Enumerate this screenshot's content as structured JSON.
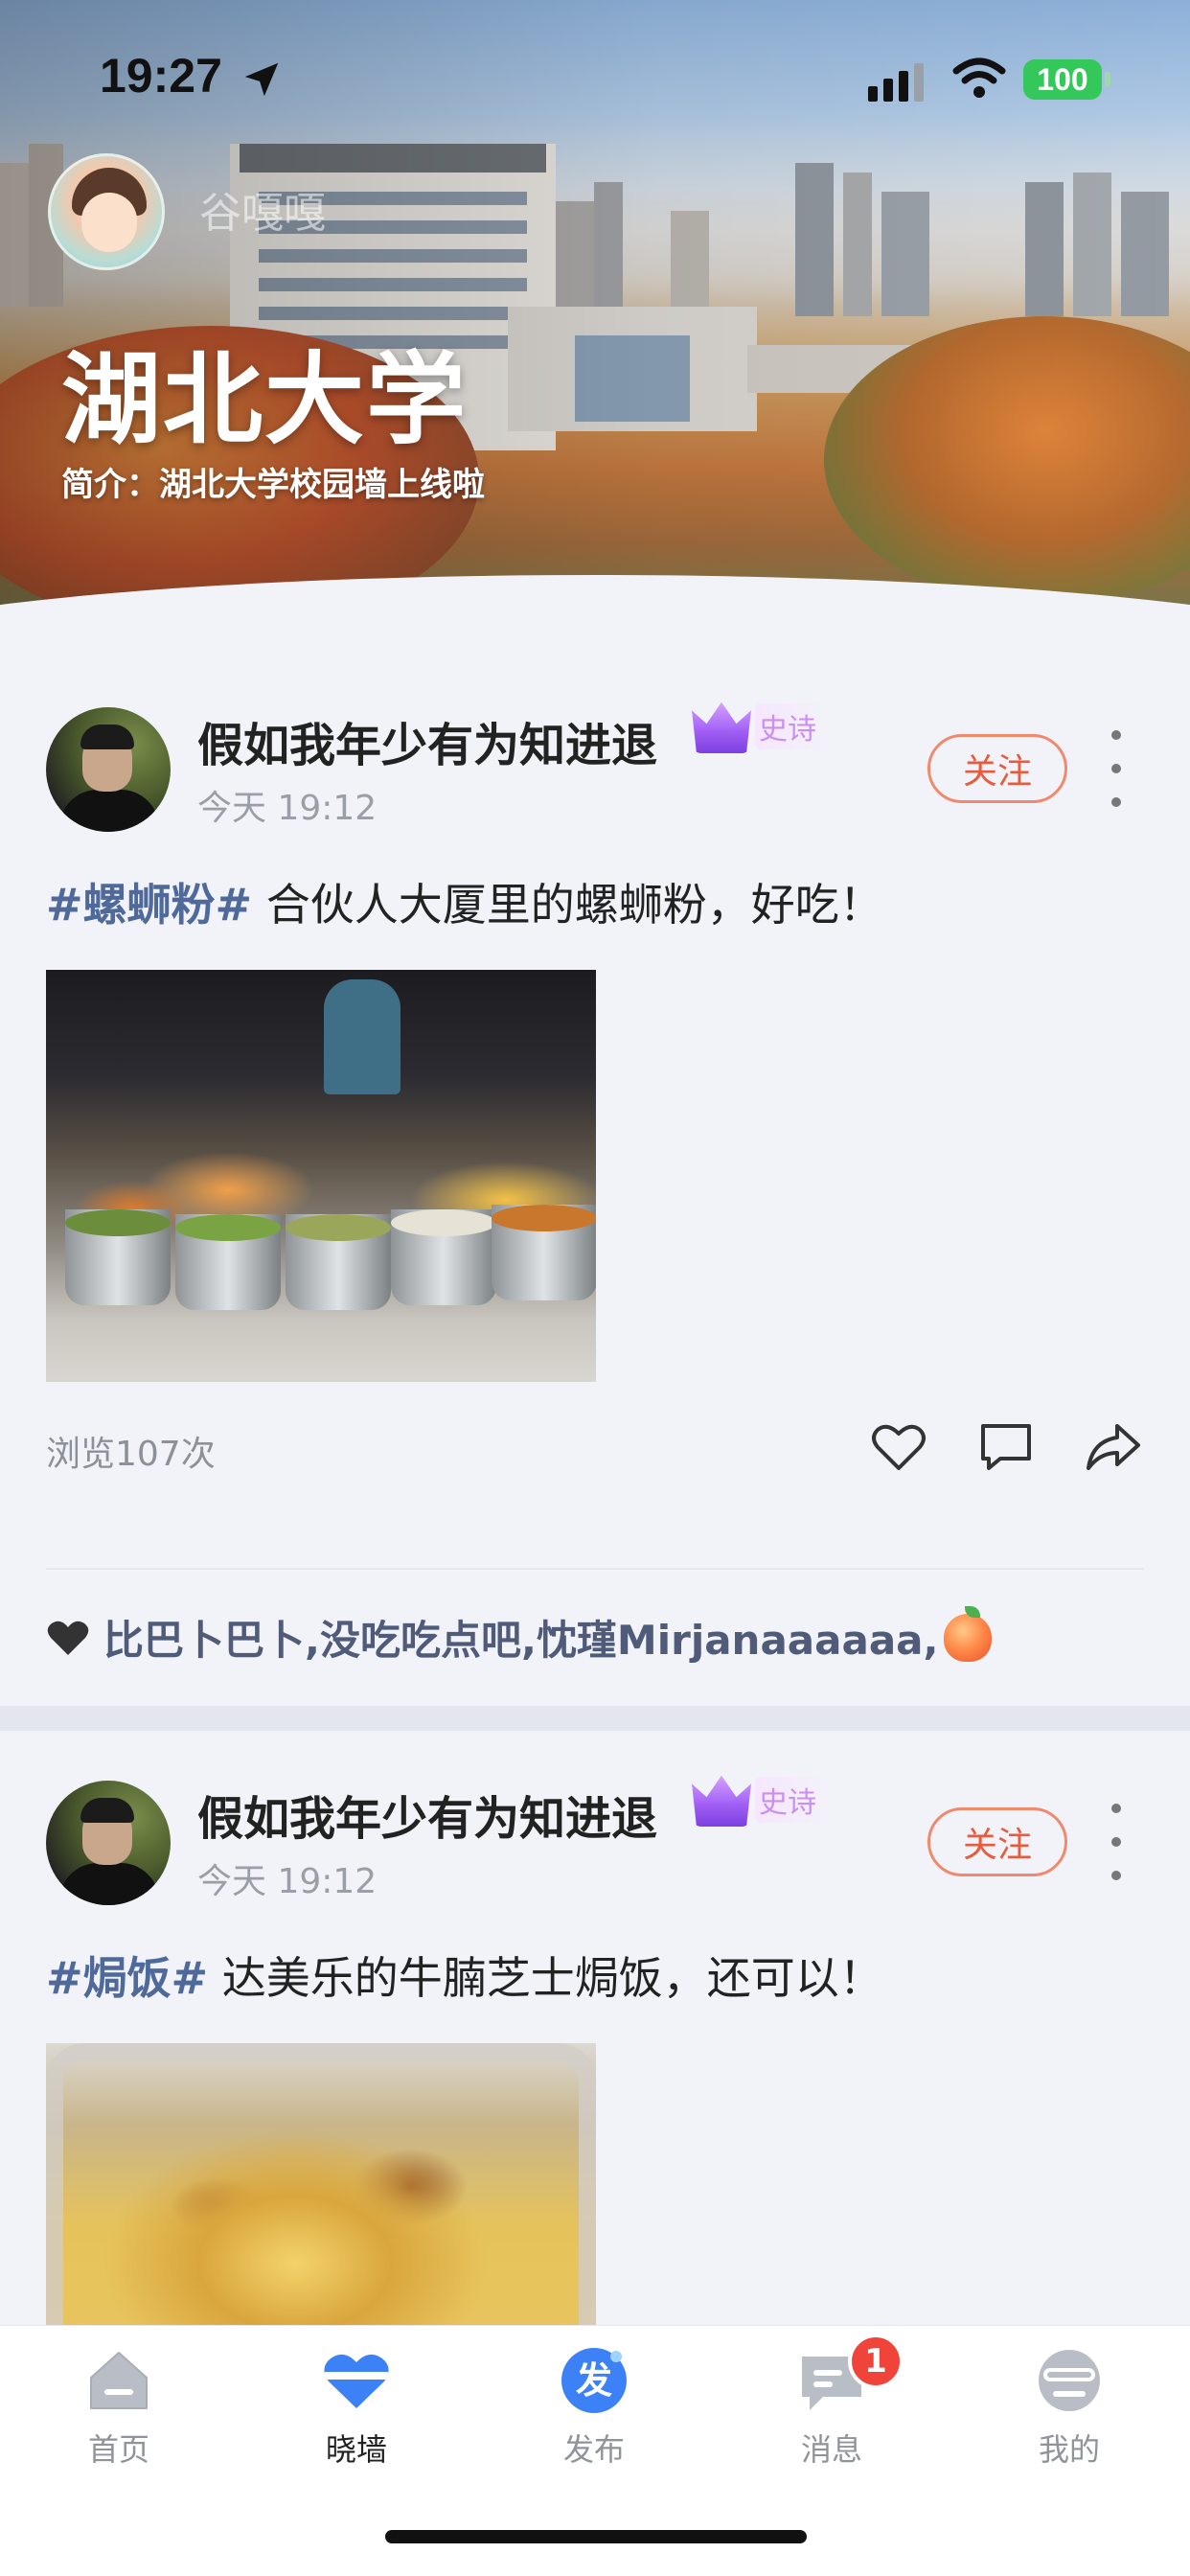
{
  "status_bar": {
    "time": "19:27",
    "battery": "100"
  },
  "header": {
    "username": "谷嘎嘎",
    "school_title": "湖北大学",
    "description": "简介：湖北大学校园墙上线啦"
  },
  "posts": [
    {
      "author": "假如我年少有为知进退",
      "badge": "史诗",
      "time": "今天 19:12",
      "follow_label": "关注",
      "tag": "#螺蛳粉#",
      "text": " 合伙人大厦里的螺蛳粉，好吃！",
      "views": "浏览107次",
      "likes_text": "比巴卜巴卜,没吃吃点吧,忱瑾Mirjanaaaaaa,"
    },
    {
      "author": "假如我年少有为知进退",
      "badge": "史诗",
      "time": "今天 19:12",
      "follow_label": "关注",
      "tag": "#焗饭#",
      "text": " 达美乐的牛腩芝士焗饭，还可以！"
    }
  ],
  "tabbar": {
    "items": [
      {
        "label": "首页",
        "icon": "home-icon"
      },
      {
        "label": "晓墙",
        "icon": "heart-wall-icon",
        "active": true
      },
      {
        "label": "发布",
        "icon": "publish-icon",
        "glyph": "发"
      },
      {
        "label": "消息",
        "icon": "message-icon",
        "badge": "1"
      },
      {
        "label": "我的",
        "icon": "profile-icon"
      }
    ]
  },
  "colors": {
    "accent_blue": "#3c82f6",
    "follow_red": "#e85b3d",
    "tag_blue": "#4f6a9a",
    "badge_red": "#f0443a",
    "battery_green": "#34c759"
  }
}
